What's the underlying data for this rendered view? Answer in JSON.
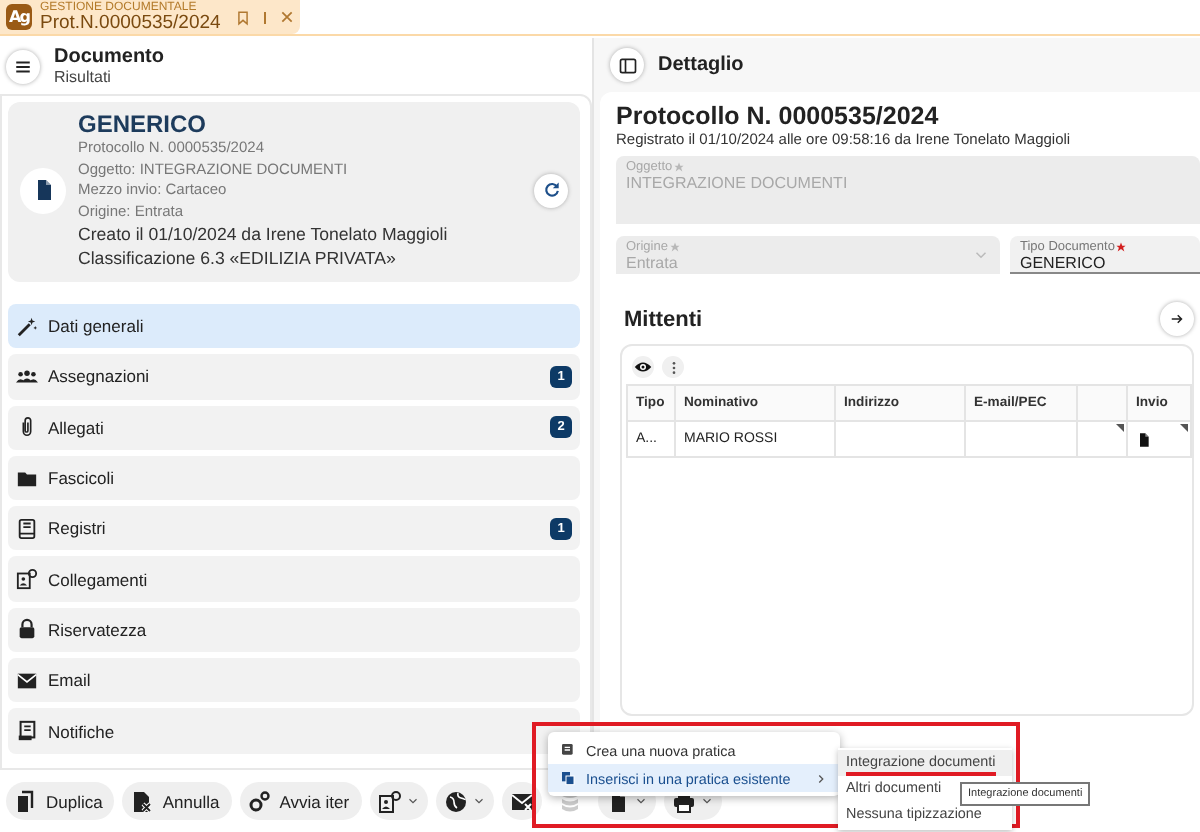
{
  "app_tab": {
    "logo": "Ag",
    "section": "GESTIONE DOCUMENTALE",
    "title": "Prot.N.0000535/2024"
  },
  "left_panel": {
    "title": "Documento",
    "subtitle": "Risultati"
  },
  "summary_card": {
    "type": "GENERICO",
    "lines": [
      "Protocollo N. 0000535/2024",
      "Oggetto: INTEGRAZIONE DOCUMENTI",
      "Mezzo invio: Cartaceo",
      "Origine: Entrata"
    ],
    "details": [
      "Creato il 01/10/2024 da Irene Tonelato Maggioli",
      "Classificazione 6.3 «EDILIZIA PRIVATA»"
    ]
  },
  "nav": [
    {
      "label": "Dati generali",
      "selected": true
    },
    {
      "label": "Assegnazioni",
      "count": "1",
      "selected": false
    },
    {
      "label": "Allegati",
      "count": "2",
      "selected": false
    },
    {
      "label": "Fascicoli",
      "selected": false
    },
    {
      "label": "Registri",
      "count": "1",
      "selected": false
    },
    {
      "label": "Collegamenti",
      "selected": false
    },
    {
      "label": "Riservatezza",
      "selected": false
    },
    {
      "label": "Email",
      "selected": false
    },
    {
      "label": "Notifiche",
      "selected": false
    }
  ],
  "detail": {
    "header": "Dettaglio",
    "title": "Protocollo N. 0000535/2024",
    "registered": "Registrato il 01/10/2024 alle ore 09:58:16 da Irene Tonelato Maggioli",
    "fields": [
      {
        "kind": "textarea",
        "label": "Oggetto",
        "required": true,
        "disabled": true,
        "value": "INTEGRAZIONE DOCUMENTI"
      },
      {
        "kind": "select",
        "label": "Origine",
        "required": true,
        "disabled": true,
        "value": "Entrata"
      },
      {
        "kind": "text",
        "label": "Tipo Documento",
        "required": true,
        "disabled": false,
        "value": "GENERICO"
      }
    ]
  },
  "mittenti": {
    "title": "Mittenti",
    "columns": [
      {
        "label": "Tipo"
      },
      {
        "label": "Nominativo"
      },
      {
        "label": "Indirizzo"
      },
      {
        "label": "E-mail/PEC"
      },
      {
        "kind": "blank"
      },
      {
        "label": "Invio"
      }
    ],
    "rows": [
      {
        "cells": [
          {
            "text": "A..."
          },
          {
            "text": "MARIO ROSSI"
          },
          {
            "kind": "empty"
          },
          {
            "kind": "empty"
          },
          {
            "kind": "empty"
          },
          {
            "kind": "file"
          }
        ]
      }
    ]
  },
  "toolbar": [
    {
      "kind": "text",
      "label": "Duplica",
      "disabled": false
    },
    {
      "kind": "text",
      "label": "Annulla",
      "disabled": false
    },
    {
      "kind": "text",
      "label": "Avvia iter",
      "disabled": false
    },
    {
      "kind": "dropdown",
      "disabled": false
    },
    {
      "kind": "dropdown",
      "disabled": false
    },
    {
      "kind": "icon",
      "disabled": false
    },
    {
      "kind": "icon",
      "disabled": true
    },
    {
      "kind": "dropdown",
      "disabled": false
    },
    {
      "kind": "dropdown",
      "disabled": false
    }
  ],
  "menu": {
    "items": [
      {
        "label": "Crea una nuova pratica",
        "selected": false,
        "submenu": false
      },
      {
        "label": "Inserisci in una pratica esistente",
        "selected": true,
        "submenu": true
      }
    ],
    "submenu": [
      {
        "label": "Integrazione documenti",
        "selected": true,
        "underlined": true
      },
      {
        "label": "Altri documenti",
        "selected": false,
        "underlined": false
      },
      {
        "label": "Nessuna tipizzazione",
        "selected": false,
        "underlined": false
      }
    ],
    "tooltip": "Integrazione documenti"
  }
}
